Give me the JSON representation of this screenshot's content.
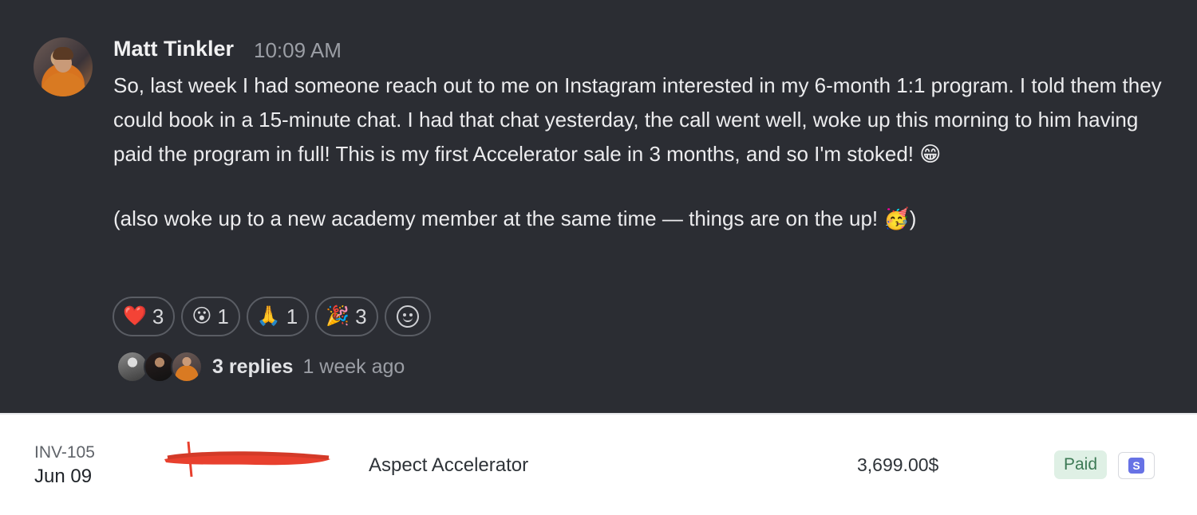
{
  "message": {
    "author": "Matt Tinkler",
    "time": "10:09 AM",
    "paragraph1": "So, last week I had someone reach out to me on Instagram interested in my 6-month 1:1 program. I told them they could book in a 15-minute chat. I had that chat yesterday, the call went well, woke up this morning to him having paid the program in full! This is my first Accelerator sale in 3 months, and so I'm stoked! 😁",
    "paragraph2": "(also woke up to a new academy member at the same time — things are on the up! 🥳)"
  },
  "reactions": [
    {
      "emoji": "❤️",
      "icon": "heart-icon",
      "count": "3"
    },
    {
      "emoji": "😮",
      "icon": "surprised-face-icon",
      "count": "1"
    },
    {
      "emoji": "🙏",
      "icon": "folded-hands-icon",
      "count": "1"
    },
    {
      "emoji": "🎉",
      "icon": "party-popper-icon",
      "count": "3"
    }
  ],
  "add_reaction_icon": "add-reaction-smiley-icon",
  "thread": {
    "replies_label": "3 replies",
    "last_reply": "1 week ago"
  },
  "invoice": {
    "id": "INV-105",
    "date": "Jun 09",
    "product": "Aspect Accelerator",
    "amount": "3,699.00$",
    "status": "Paid",
    "payment_badge": "S",
    "payment_badge_color": "#6772e5",
    "status_color": "#3d7a55"
  },
  "colors": {
    "chat_background": "#2b2d33",
    "invoice_background": "#ffffff",
    "redaction": "#e8402e"
  }
}
